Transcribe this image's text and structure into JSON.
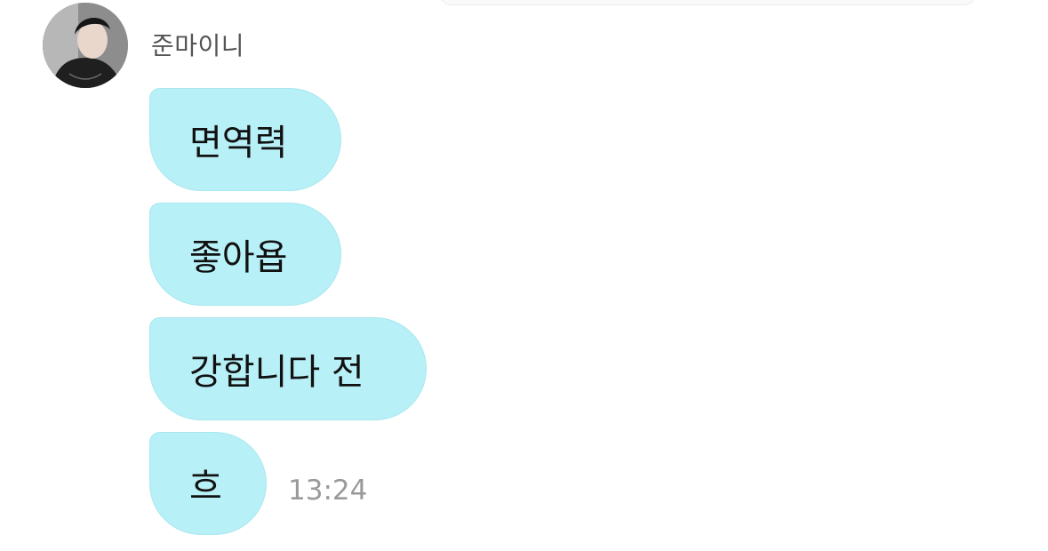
{
  "sender": {
    "name": "준마이니",
    "avatar_icon": "profile-photo"
  },
  "messages": [
    {
      "text": "면역력"
    },
    {
      "text": "좋아욥"
    },
    {
      "text": "강합니다 전"
    },
    {
      "text": "흐"
    }
  ],
  "timestamp": "13:24",
  "colors": {
    "bubble": "#b7f0f6",
    "bubble_border": "#a9e8ef",
    "name_text": "#555555",
    "timestamp_text": "#9a9a9a"
  }
}
